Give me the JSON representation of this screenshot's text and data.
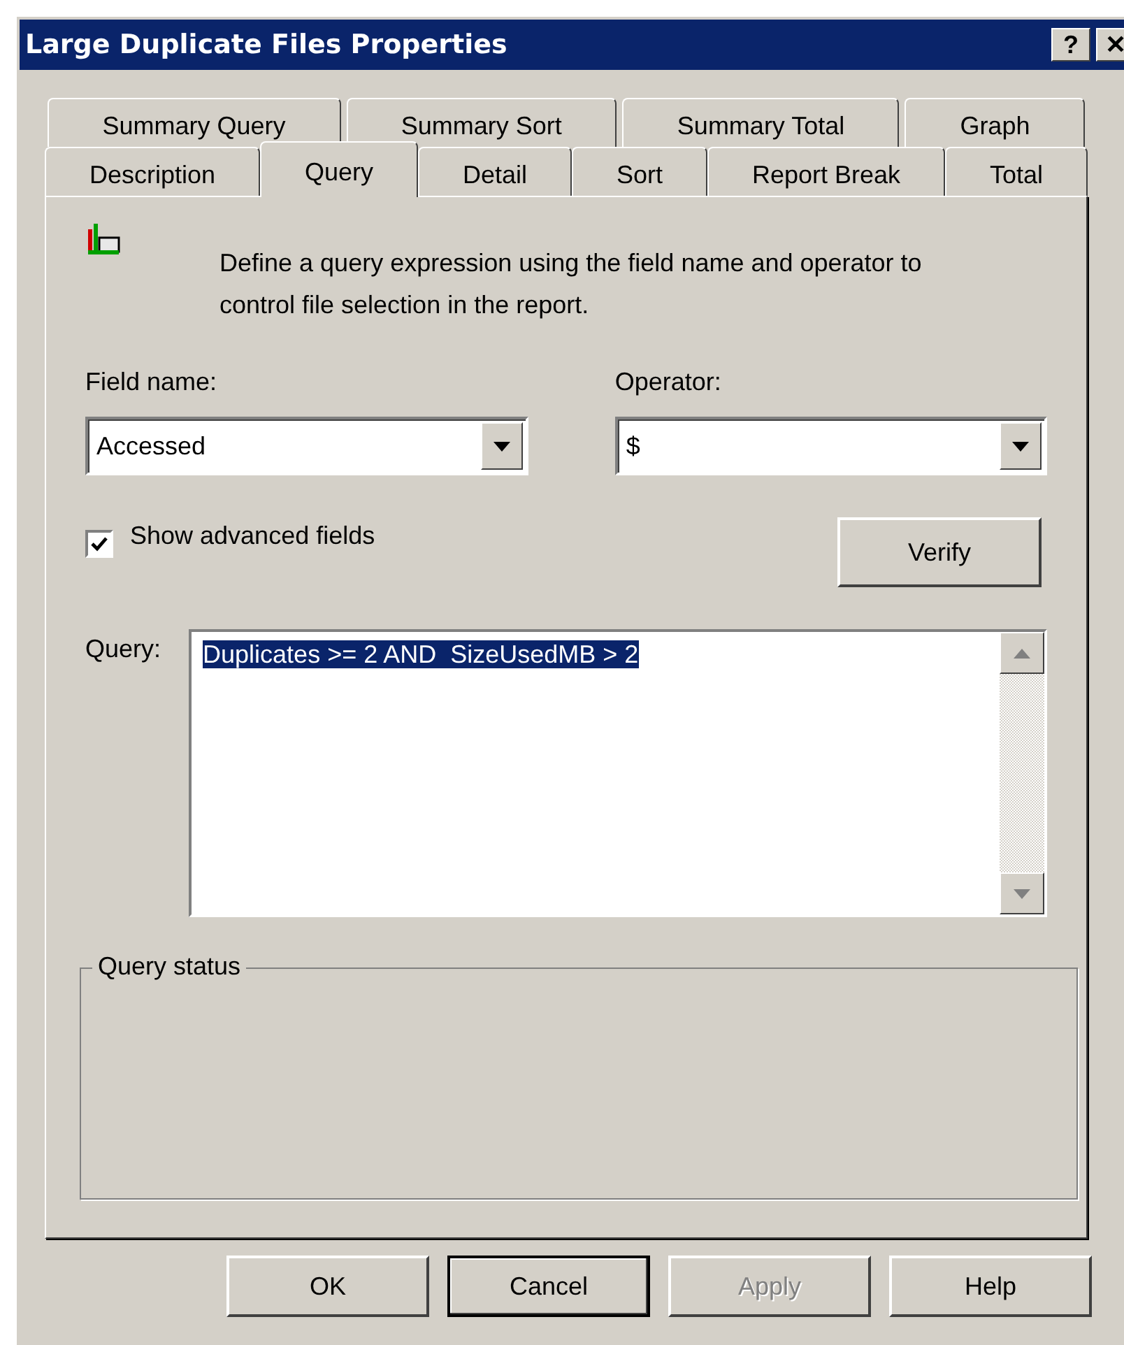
{
  "window": {
    "title": "Large Duplicate Files Properties",
    "help_button": "?",
    "close_button": "✕"
  },
  "tab_rows": [
    [
      {
        "label": "Summary Query",
        "selected": false
      },
      {
        "label": "Summary Sort",
        "selected": false
      },
      {
        "label": "Summary Total",
        "selected": false
      },
      {
        "label": "Graph",
        "selected": false
      }
    ],
    [
      {
        "label": "Description",
        "selected": false
      },
      {
        "label": "Query",
        "selected": true
      },
      {
        "label": "Detail",
        "selected": false
      },
      {
        "label": "Sort",
        "selected": false
      },
      {
        "label": "Report Break",
        "selected": false
      },
      {
        "label": "Total",
        "selected": false
      }
    ]
  ],
  "description": "Define a query expression using the field name and operator to control file selection in the report.",
  "field_name": {
    "label": "Field name:",
    "value": "Accessed"
  },
  "operator": {
    "label": "Operator:",
    "value": "$"
  },
  "show_advanced_fields": {
    "label": "Show advanced fields",
    "checked": true
  },
  "verify_button": "Verify",
  "query": {
    "label": "Query:",
    "value": "Duplicates >= 2 AND  SizeUsedMB > 2",
    "selected": true
  },
  "query_status": {
    "label": "Query status"
  },
  "buttons": [
    {
      "label": "OK",
      "disabled": false,
      "default": false
    },
    {
      "label": "Cancel",
      "disabled": false,
      "default": true
    },
    {
      "label": "Apply",
      "disabled": true,
      "default": false
    },
    {
      "label": "Help",
      "disabled": false,
      "default": false
    }
  ]
}
